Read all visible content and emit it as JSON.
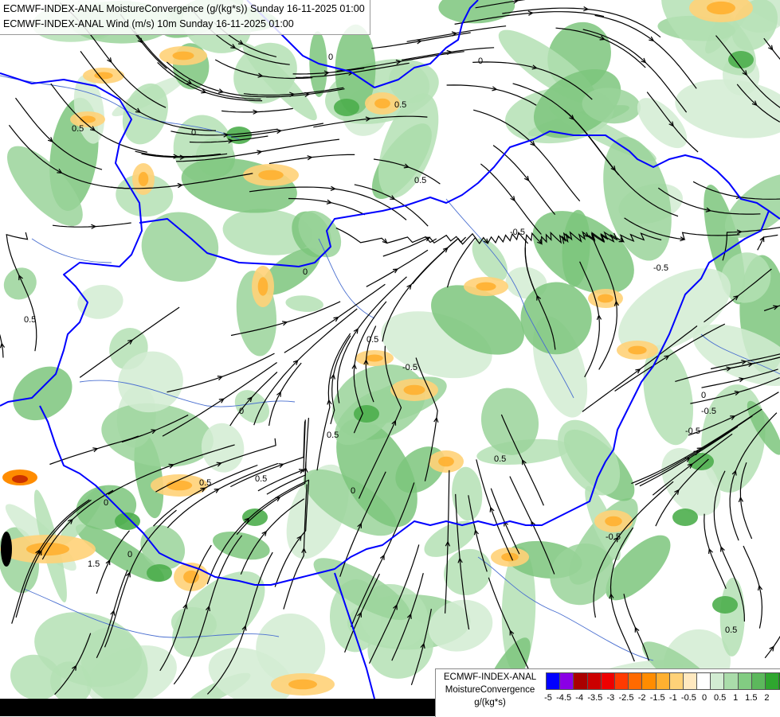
{
  "titles": {
    "line1": "ECMWF-INDEX-ANAL MoistureConvergence (g/(kg*s)) Sunday 16-11-2025 01:00",
    "line2": "ECMWF-INDEX-ANAL Wind (m/s) 10m Sunday 16-11-2025 01:00"
  },
  "legend": {
    "line1": "ECMWF-INDEX-ANAL",
    "line2": "MoistureConvergence",
    "line3": "g/(kg*s)",
    "colors": [
      "#0000ff",
      "#8a00e6",
      "#aa0000",
      "#cc0000",
      "#ee0000",
      "#ff3a00",
      "#ff6a00",
      "#ff8c00",
      "#ffb030",
      "#ffd278",
      "#ffe9c0",
      "#ffffff",
      "#d2ecd2",
      "#aadcaa",
      "#82cc82",
      "#5cb85c",
      "#2ea62e",
      "#079607"
    ],
    "ticks": [
      "-5",
      "-4.5",
      "-4",
      "-3.5",
      "-3",
      "-2.5",
      "-2",
      "-1.5",
      "-1",
      "-0.5",
      "0",
      "0.5",
      "1",
      "1.5",
      "2"
    ]
  },
  "map_labels": [
    "0",
    "0.5",
    "-0.5",
    "1.5",
    "0.5",
    "0",
    "-0.5",
    "0.5",
    "0",
    "0.5",
    "-0.5",
    "0",
    "0.5",
    "0",
    "-0.5",
    "0.5",
    "0",
    "0.5",
    "0",
    "-0.5",
    "0.5",
    "0",
    "0.5",
    "-0.5",
    "0",
    "0.5"
  ],
  "colors": {
    "border": "#0000ff",
    "river": "#4a6fd0",
    "streamline": "#000000"
  }
}
